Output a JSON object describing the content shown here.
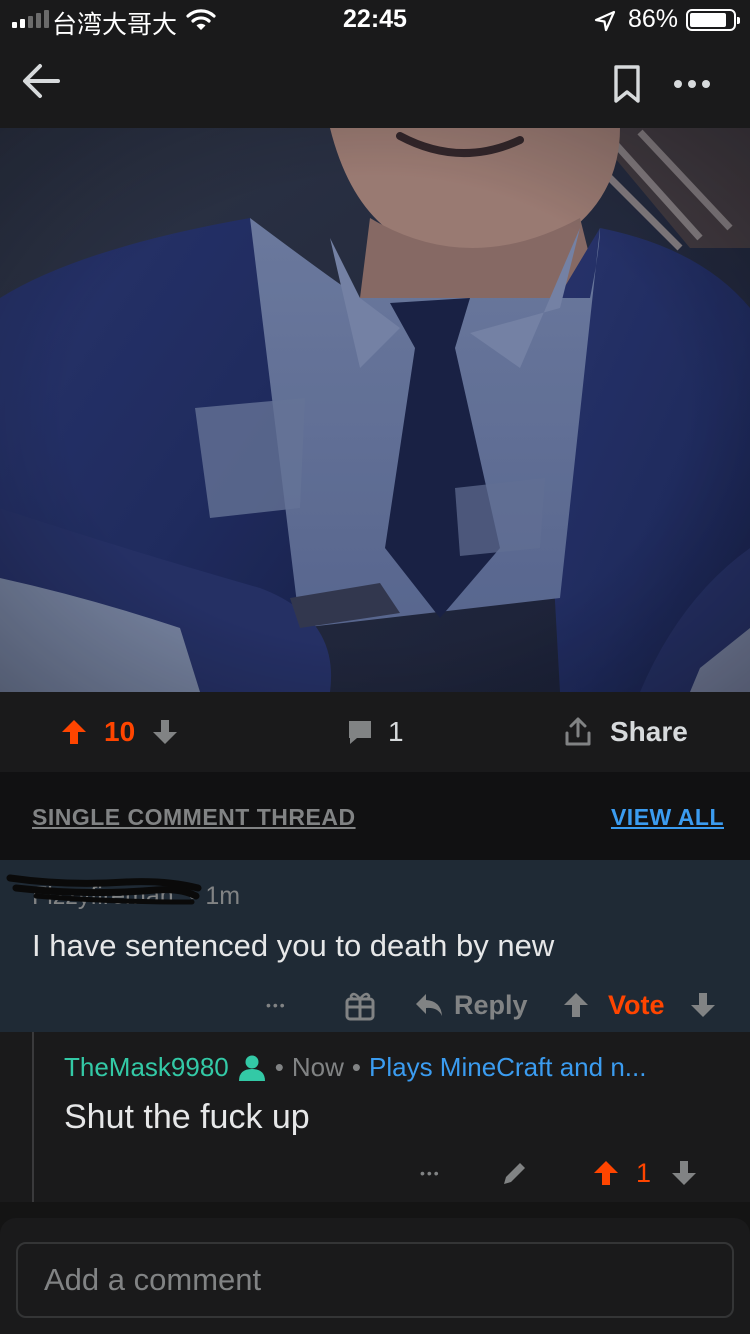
{
  "status_bar": {
    "carrier": "台湾大哥大",
    "time": "22:45",
    "battery": "86%",
    "battery_level": 0.86,
    "signal_bars": 2,
    "icons": [
      "signal-icon",
      "wifi-icon",
      "location-arrow-icon",
      "battery-icon"
    ]
  },
  "nav": {
    "icons": [
      "back-arrow-icon",
      "bookmark-icon",
      "more-icon"
    ]
  },
  "post_actions": {
    "upvotes": "10",
    "comments": "1",
    "share_label": "Share"
  },
  "thread": {
    "title": "SINGLE COMMENT THREAD",
    "view_all": "VIEW ALL"
  },
  "parent_comment": {
    "author": "Fizzyfireman",
    "time": "1m",
    "separator": "•",
    "body": "I have sentenced you to death by new",
    "more": "•••",
    "reply_label": "Reply",
    "vote_label": "Vote"
  },
  "reply_comment": {
    "author": "TheMask9980",
    "time": "Now",
    "separator": "•",
    "flair": "Plays MineCraft and n...",
    "body": "Shut the fuck up",
    "more": "•••",
    "score": "1"
  },
  "composer": {
    "placeholder": "Add a comment"
  },
  "colors": {
    "upvote": "#ff4500",
    "link": "#3b9cf0",
    "username": "#33c9a6",
    "parent_bg": "#1f2a35",
    "card_bg": "#1a1a1b"
  }
}
